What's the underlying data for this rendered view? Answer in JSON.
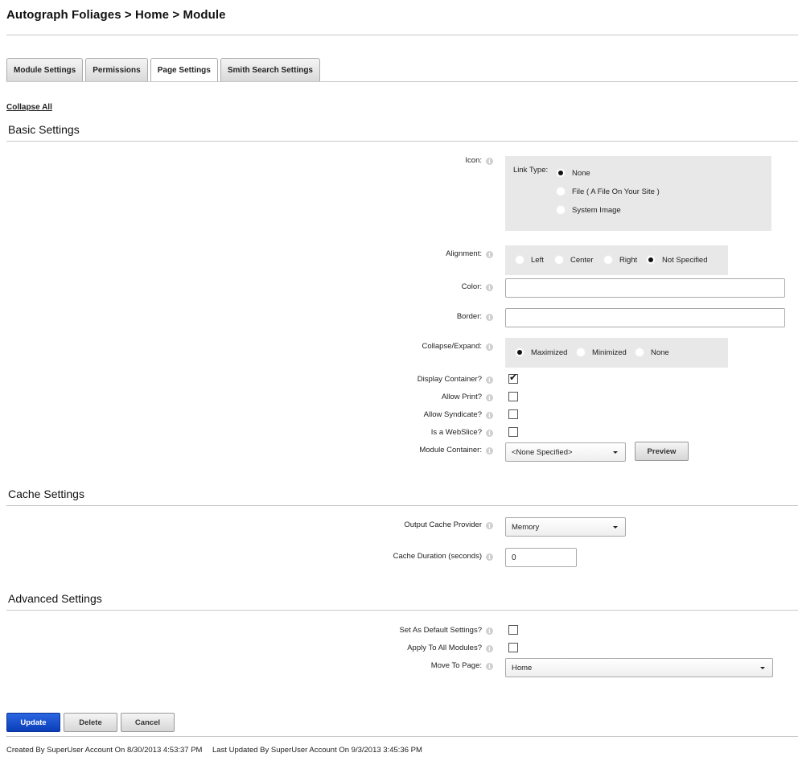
{
  "breadcrumb": "Autograph Foliages > Home > Module",
  "tabs": [
    "Module Settings",
    "Permissions",
    "Page Settings",
    "Smith Search Settings"
  ],
  "collapse_all": "Collapse All",
  "basic": {
    "title": "Basic Settings",
    "icon_label": "Icon:",
    "link_type_label": "Link Type:",
    "link_types": [
      "None",
      "File ( A File On Your Site )",
      "System Image"
    ],
    "link_type_selected": "None",
    "alignment_label": "Alignment:",
    "alignments": [
      "Left",
      "Center",
      "Right",
      "Not Specified"
    ],
    "alignment_selected": "Not Specified",
    "color_label": "Color:",
    "color_value": "",
    "border_label": "Border:",
    "border_value": "",
    "collapse_label": "Collapse/Expand:",
    "collapse_options": [
      "Maximized",
      "Minimized",
      "None"
    ],
    "collapse_selected": "Maximized",
    "display_container_label": "Display Container?",
    "display_container_checked": true,
    "allow_print_label": "Allow Print?",
    "allow_print_checked": false,
    "allow_syndicate_label": "Allow Syndicate?",
    "allow_syndicate_checked": false,
    "webslice_label": "Is a WebSlice?",
    "webslice_checked": false,
    "module_container_label": "Module Container:",
    "module_container_value": "<None Specified>",
    "preview_button": "Preview"
  },
  "cache": {
    "title": "Cache Settings",
    "provider_label": "Output Cache Provider",
    "provider_value": "Memory",
    "duration_label": "Cache Duration (seconds)",
    "duration_value": "0"
  },
  "advanced": {
    "title": "Advanced Settings",
    "default_label": "Set As Default Settings?",
    "default_checked": false,
    "apply_all_label": "Apply To All Modules?",
    "apply_all_checked": false,
    "move_label": "Move To Page:",
    "move_value": "Home"
  },
  "actions": {
    "update": "Update",
    "delete": "Delete",
    "cancel": "Cancel"
  },
  "footer": {
    "created": "Created By SuperUser Account On 8/30/2013 4:53:37 PM",
    "updated": "Last Updated By SuperUser Account On 9/3/2013 3:45:36 PM"
  },
  "colors": {
    "primary_button": "#0a3db9",
    "panel_bg": "#e8e8e8",
    "divider": "#c8c8c8"
  },
  "icon_names": [
    "info-icon",
    "radio-icon",
    "checkbox-icon",
    "dropdown-caret-icon"
  ]
}
